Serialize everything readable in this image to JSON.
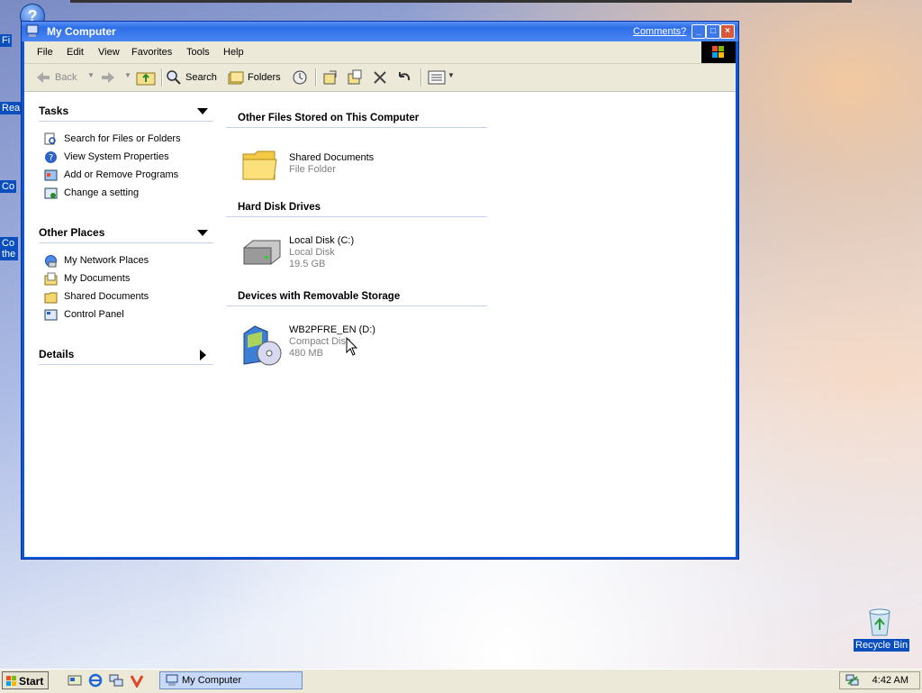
{
  "desktop": {
    "help_icon_glyph": "?",
    "left_labels": [
      "Fi",
      "Rea",
      "Co",
      "Co the"
    ],
    "recycle_bin_label": "Recycle Bin"
  },
  "window": {
    "title": "My Computer",
    "comments_link": "Comments?",
    "buttons": {
      "minimize": "_",
      "maximize": "□",
      "close": "×"
    }
  },
  "menubar": [
    "File",
    "Edit",
    "View",
    "Favorites",
    "Tools",
    "Help"
  ],
  "toolbar": {
    "back": "Back",
    "search": "Search",
    "folders": "Folders"
  },
  "left_pane": {
    "tasks": {
      "title": "Tasks",
      "items": [
        "Search for Files or Folders",
        "View System Properties",
        "Add or Remove Programs",
        "Change a setting"
      ]
    },
    "other_places": {
      "title": "Other Places",
      "items": [
        "My Network Places",
        "My Documents",
        "Shared Documents",
        "Control Panel"
      ]
    },
    "details": {
      "title": "Details"
    }
  },
  "groups": {
    "other_files": {
      "title": "Other Files Stored on This Computer",
      "items": [
        {
          "name": "Shared Documents",
          "type": "File Folder"
        }
      ]
    },
    "hard_disks": {
      "title": "Hard Disk Drives",
      "items": [
        {
          "name": "Local Disk (C:)",
          "type": "Local Disk",
          "size": "19.5 GB"
        }
      ]
    },
    "removable": {
      "title": "Devices with Removable Storage",
      "items": [
        {
          "name": "WB2PFRE_EN (D:)",
          "type": "Compact Disc",
          "size": "480 MB"
        }
      ]
    }
  },
  "taskbar": {
    "start_label": "Start",
    "task_button": "My Computer",
    "clock": "4:42 AM"
  },
  "colors": {
    "title_blue": "#2d6ee8",
    "pane_line": "#c6d3f0",
    "taskbar": "#ece9d8"
  }
}
